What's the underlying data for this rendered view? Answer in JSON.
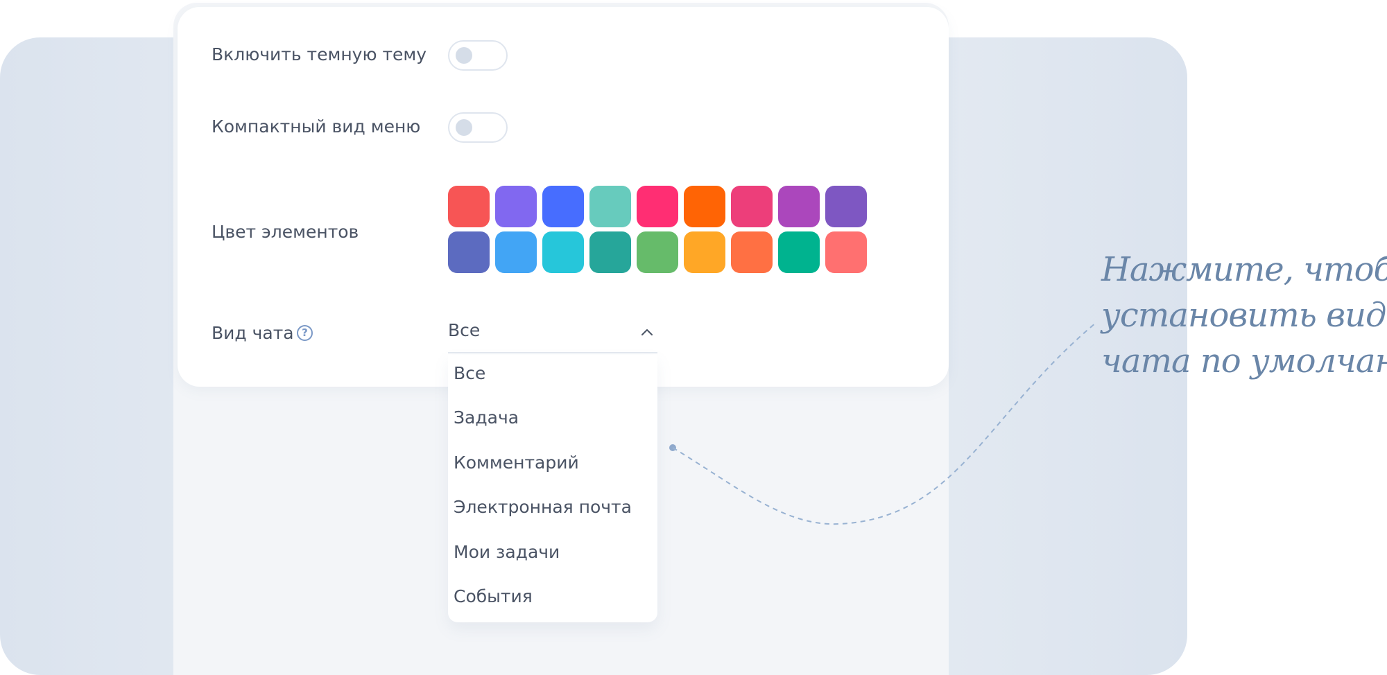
{
  "settings": {
    "dark_theme_label": "Включить темную тему",
    "compact_menu_label": "Компактный вид меню",
    "element_color_label": "Цвет элементов",
    "chat_view_label": "Вид чата",
    "help_symbol": "?",
    "dark_theme_on": false,
    "compact_menu_on": false
  },
  "colors": {
    "swatches": [
      "#f75555",
      "#8168f0",
      "#476dff",
      "#67cbbd",
      "#ff2e73",
      "#ff6405",
      "#ed3e7a",
      "#ab47bc",
      "#7e57c2",
      "#5c6bc0",
      "#42a5f5",
      "#26c6da",
      "#26a69a",
      "#66bb6a",
      "#ffa726",
      "#ff7043",
      "#00b38f",
      "#ff7070"
    ]
  },
  "chat_view": {
    "selected": "Все",
    "options": [
      "Все",
      "Задача",
      "Комментарий",
      "Электронная почта",
      "Мои задачи",
      "События"
    ]
  },
  "annotation": {
    "line1": "Нажмите, чтобы",
    "line2": "установить вид",
    "line3": "чата по умолчанию"
  }
}
